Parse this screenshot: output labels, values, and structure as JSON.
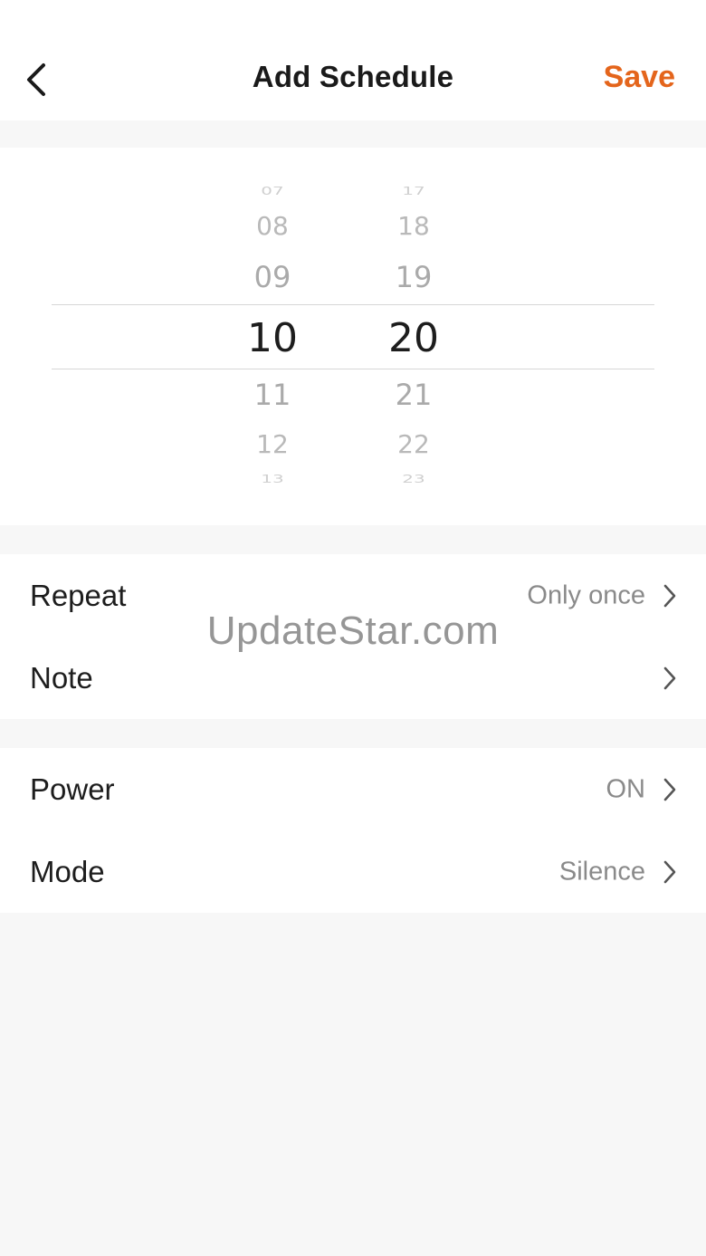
{
  "header": {
    "back_icon": "chevron-left-icon",
    "title": "Add Schedule",
    "save_label": "Save",
    "accent_color": "#e4651c"
  },
  "time_picker": {
    "hours": [
      "07",
      "08",
      "09",
      "10",
      "11",
      "12",
      "13"
    ],
    "minutes": [
      "17",
      "18",
      "19",
      "20",
      "21",
      "22",
      "23"
    ],
    "selected_hour": "10",
    "selected_minute": "20"
  },
  "settings": {
    "repeat": {
      "label": "Repeat",
      "value": "Only once"
    },
    "note": {
      "label": "Note",
      "value": ""
    },
    "power": {
      "label": "Power",
      "value": "ON"
    },
    "mode": {
      "label": "Mode",
      "value": "Silence"
    }
  },
  "watermark": "UpdateStar.com"
}
